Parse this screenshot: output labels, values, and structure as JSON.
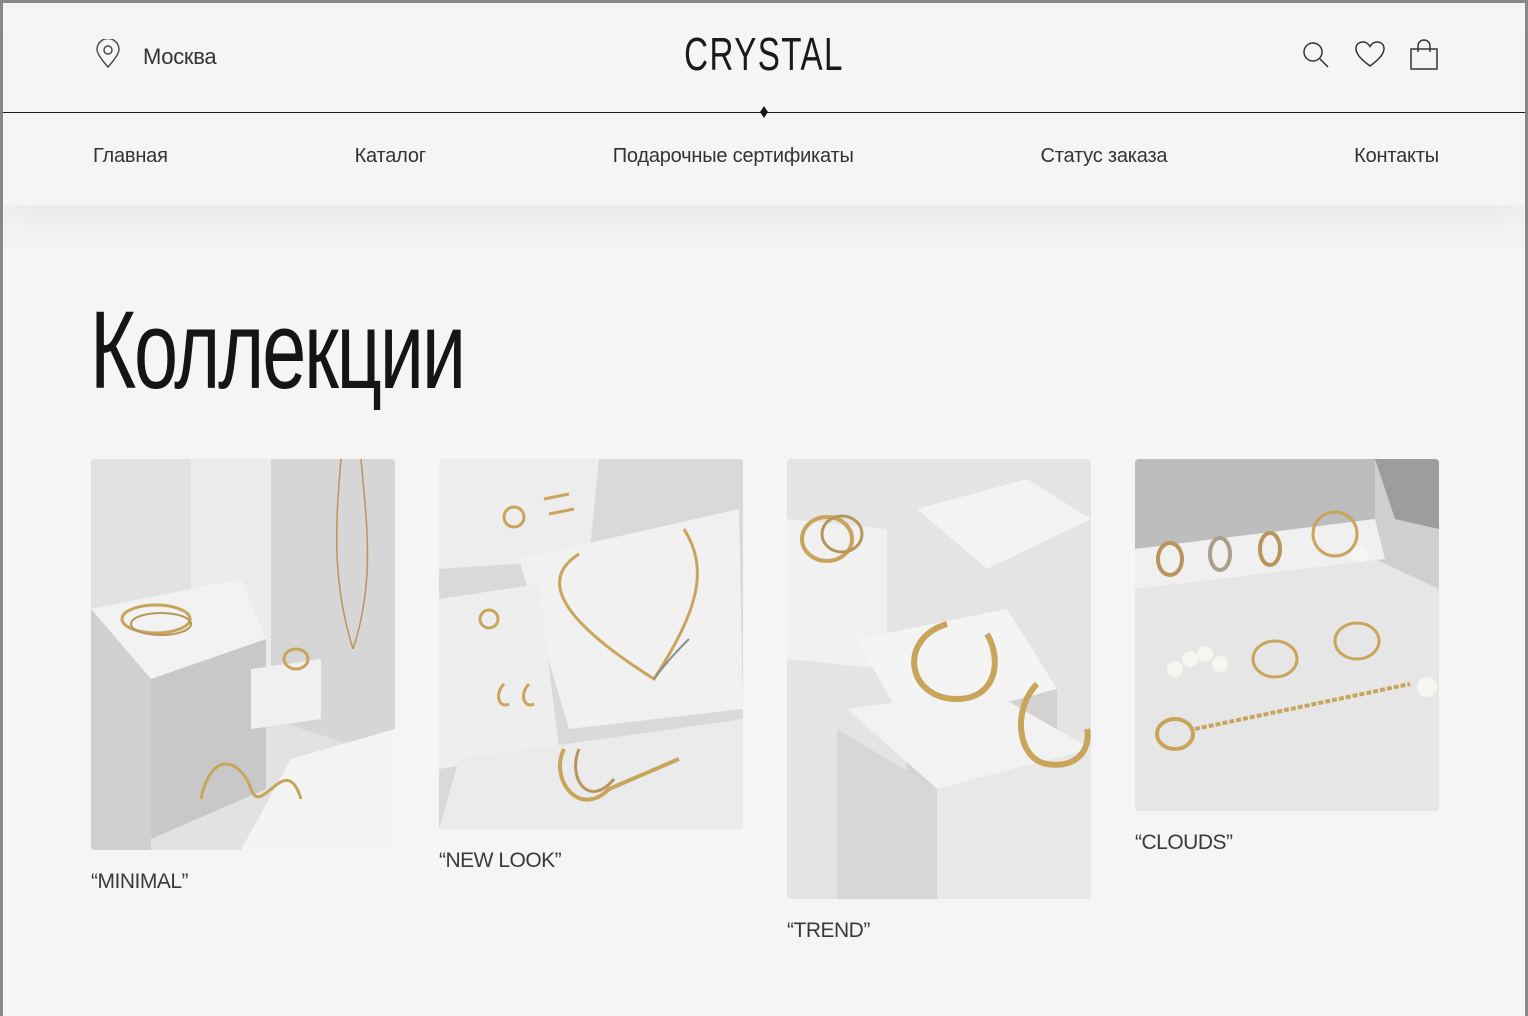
{
  "header": {
    "city": "Москва",
    "logo": "CRYSTAL",
    "icons": [
      "map-pin-icon",
      "search-icon",
      "heart-icon",
      "bag-icon"
    ]
  },
  "nav": {
    "items": [
      {
        "label": "Главная"
      },
      {
        "label": "Каталог"
      },
      {
        "label": "Подарочные сертификаты"
      },
      {
        "label": "Статус заказа"
      },
      {
        "label": "Контакты"
      }
    ]
  },
  "main": {
    "title": "Коллекции",
    "collections": [
      {
        "caption": "“MINIMAL”"
      },
      {
        "caption": "“NEW LOOK”"
      },
      {
        "caption": "“TREND”"
      },
      {
        "caption": "“CLOUDS”"
      }
    ]
  },
  "colors": {
    "background": "#f5f5f5",
    "text": "#1a1a1a",
    "gold": "#c9a55c"
  }
}
